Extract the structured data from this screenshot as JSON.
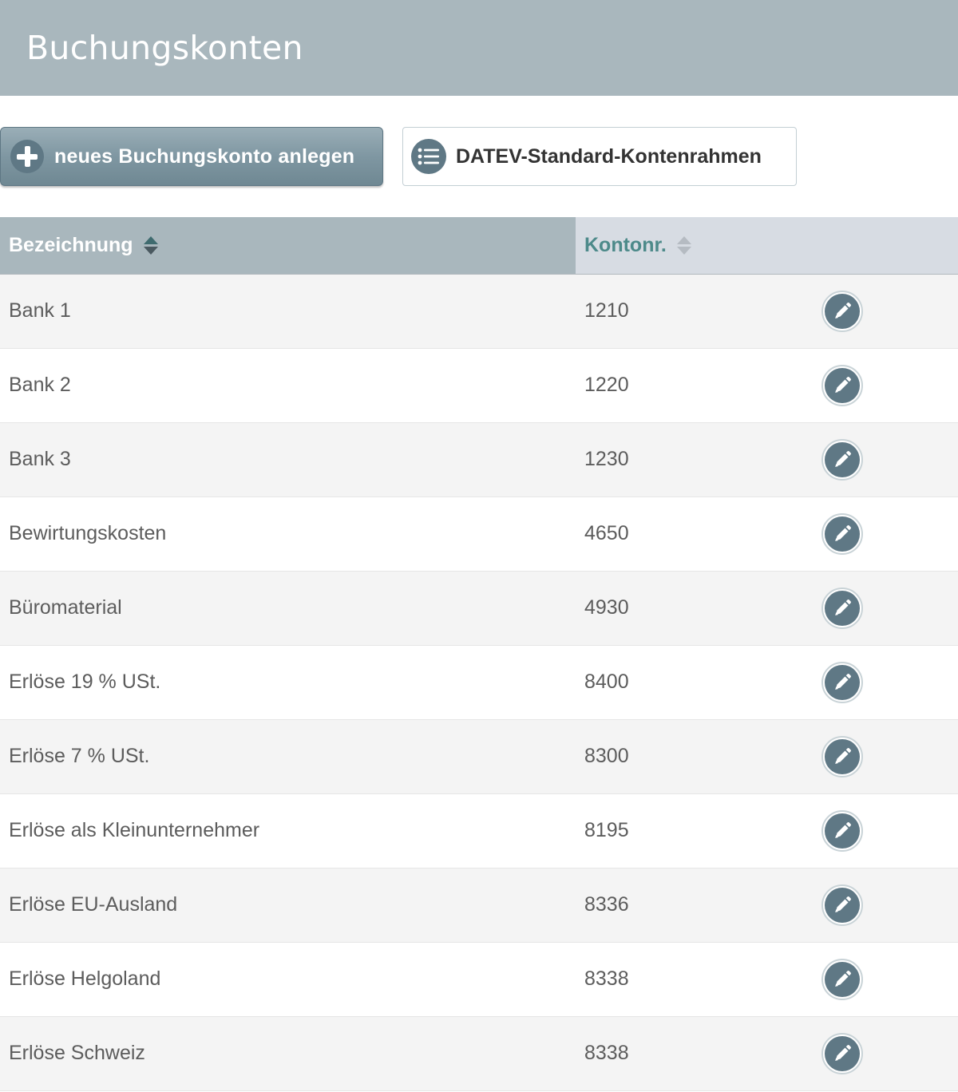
{
  "header": {
    "title": "Buchungskonten"
  },
  "toolbar": {
    "new_account_label": "neues Buchungskonto anlegen",
    "datev_label": "DATEV-Standard-Kontenrahmen"
  },
  "table": {
    "columns": {
      "name": "Bezeichnung",
      "number": "Kontonr."
    },
    "sort": {
      "column": "Bezeichnung",
      "direction": "ascending"
    },
    "rows": [
      {
        "name": "Bank 1",
        "number": "1210"
      },
      {
        "name": "Bank 2",
        "number": "1220"
      },
      {
        "name": "Bank 3",
        "number": "1230"
      },
      {
        "name": "Bewirtungskosten",
        "number": "4650"
      },
      {
        "name": "Büromaterial",
        "number": "4930"
      },
      {
        "name": "Erlöse 19 % USt.",
        "number": "8400"
      },
      {
        "name": "Erlöse 7 % USt.",
        "number": "8300"
      },
      {
        "name": "Erlöse als Kleinunternehmer",
        "number": "8195"
      },
      {
        "name": "Erlöse EU-Ausland",
        "number": "8336"
      },
      {
        "name": "Erlöse Helgoland",
        "number": "8338"
      },
      {
        "name": "Erlöse Schweiz",
        "number": "8338"
      }
    ]
  },
  "icons": {
    "new": "plus-icon",
    "datev": "list-icon",
    "edit": "pencil-icon"
  },
  "colors": {
    "header_bg": "#a9b7bd",
    "button_bg": "#7f97a2",
    "icon_circle": "#5f7885",
    "sorted_column_text": "#4d8a8a"
  }
}
